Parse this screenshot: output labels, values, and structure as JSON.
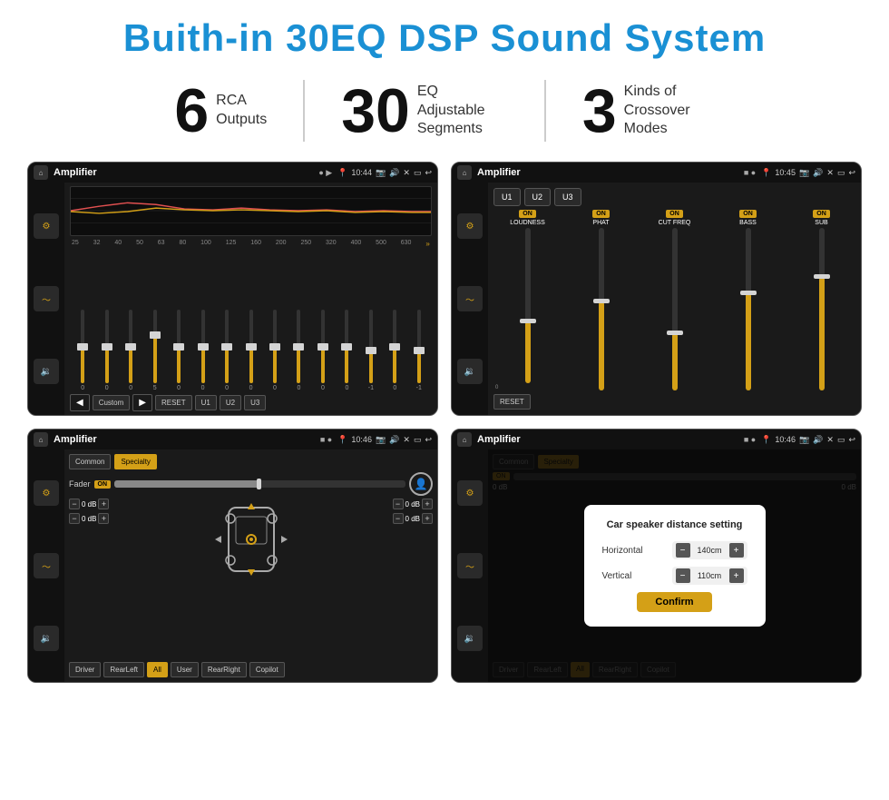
{
  "page": {
    "title": "Buith-in 30EQ DSP Sound System",
    "background_color": "#ffffff"
  },
  "stats": [
    {
      "number": "6",
      "label": "RCA\nOutputs"
    },
    {
      "number": "30",
      "label": "EQ Adjustable\nSegments"
    },
    {
      "number": "3",
      "label": "Kinds of\nCrossover Modes"
    }
  ],
  "screens": [
    {
      "id": "eq-screen",
      "title": "Amplifier",
      "time": "10:44",
      "type": "eq",
      "freqs": [
        "25",
        "32",
        "40",
        "50",
        "63",
        "80",
        "100",
        "125",
        "160",
        "200",
        "250",
        "320",
        "400",
        "500",
        "630"
      ],
      "values": [
        "0",
        "0",
        "0",
        "5",
        "0",
        "0",
        "0",
        "0",
        "0",
        "0",
        "0",
        "0",
        "-1",
        "0",
        "-1"
      ],
      "preset": "Custom",
      "buttons": [
        "RESET",
        "U1",
        "U2",
        "U3"
      ]
    },
    {
      "id": "crossover-screen",
      "title": "Amplifier",
      "time": "10:45",
      "type": "crossover",
      "presets": [
        "U1",
        "U2",
        "U3"
      ],
      "channels": [
        {
          "label": "LOUDNESS",
          "on": true
        },
        {
          "label": "PHAT",
          "on": true
        },
        {
          "label": "CUT FREQ",
          "on": true
        },
        {
          "label": "BASS",
          "on": true
        },
        {
          "label": "SUB",
          "on": true
        }
      ],
      "reset_label": "RESET"
    },
    {
      "id": "fader-screen",
      "title": "Amplifier",
      "time": "10:46",
      "type": "fader",
      "tabs": [
        "Common",
        "Specialty"
      ],
      "fader_label": "Fader",
      "fader_on": "ON",
      "db_values": [
        "0 dB",
        "0 dB",
        "0 dB",
        "0 dB"
      ],
      "buttons": [
        "Driver",
        "RearLeft",
        "All",
        "User",
        "RearRight",
        "Copilot"
      ]
    },
    {
      "id": "dist-screen",
      "title": "Amplifier",
      "time": "10:46",
      "type": "distance",
      "tabs": [
        "Common",
        "Specialty"
      ],
      "dialog": {
        "title": "Car speaker distance setting",
        "horizontal_label": "Horizontal",
        "horizontal_value": "140cm",
        "vertical_label": "Vertical",
        "vertical_value": "110cm",
        "confirm_label": "Confirm"
      },
      "db_values": [
        "0 dB",
        "0 dB"
      ],
      "buttons": [
        "Driver",
        "RearLeft",
        "All",
        "User",
        "RearRight",
        "Copilot"
      ]
    }
  ]
}
